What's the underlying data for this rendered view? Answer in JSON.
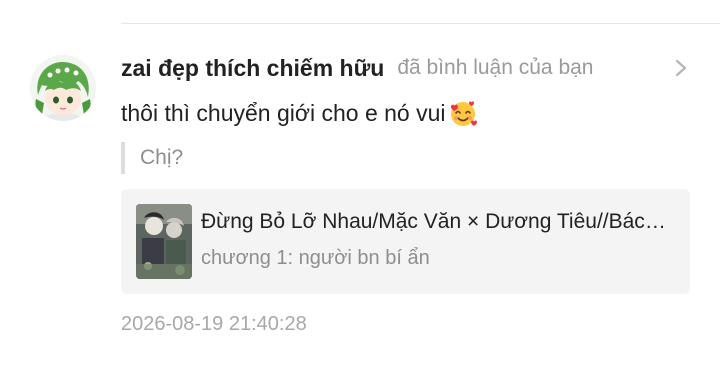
{
  "notification": {
    "username": "zai đẹp thích chiếm hữu",
    "action": "đã bình luận của bạn",
    "comment_text": "thôi thì chuyển giới cho e nó vui",
    "comment_emoji": "smiling-face-with-hearts-icon",
    "quoted_text": "Chị?",
    "story_card": {
      "title": "Đừng Bỏ Lỡ Nhau/Mặc Văn × Dương Tiêu//Bách Hợp",
      "chapter": "chương 1: người bn bí ẩn"
    },
    "timestamp": "2026-08-19 21:40:28"
  },
  "colors": {
    "background": "#ffffff",
    "username": "#222222",
    "secondary_text": "#9a9a9a",
    "card_background": "#f4f4f4",
    "quote_bar": "#dcdcdc"
  },
  "icons": {
    "chevron": "chevron-right-icon",
    "avatar": "user-avatar",
    "cover": "story-cover-thumbnail"
  }
}
